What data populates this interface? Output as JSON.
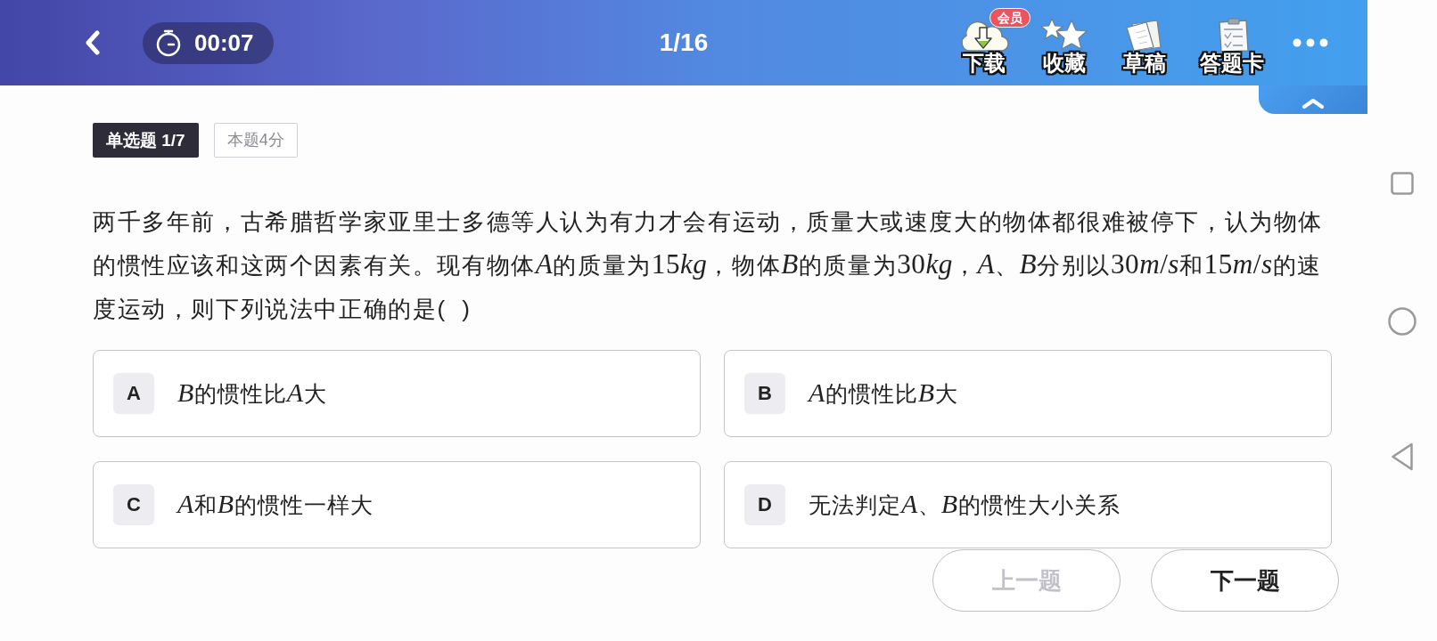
{
  "header": {
    "timer": "00:07",
    "progress": "1/16",
    "tools": [
      {
        "kind": "download",
        "label": "下载",
        "badge": "会员"
      },
      {
        "kind": "favorite",
        "label": "收藏"
      },
      {
        "kind": "draft",
        "label": "草稿"
      },
      {
        "kind": "answer_card",
        "label": "答题卡"
      }
    ]
  },
  "question": {
    "type_tag": "单选题 1/7",
    "score": "本题4分",
    "text_runs": [
      {
        "kind": "text",
        "text": "两千多年前，古希腊哲学家亚里士多德等人认为有力才会有运动，质量大或速度大的物体都很难被停下，认为物体的惯性应该和这两个因素有关。现有物体"
      },
      {
        "kind": "math_var",
        "text": "A"
      },
      {
        "kind": "text",
        "text": "的质量为"
      },
      {
        "kind": "math_num",
        "text": "15"
      },
      {
        "kind": "math_var",
        "text": "kg"
      },
      {
        "kind": "text",
        "text": "，物体"
      },
      {
        "kind": "math_var",
        "text": "B"
      },
      {
        "kind": "text",
        "text": "的质量为"
      },
      {
        "kind": "math_num",
        "text": "30"
      },
      {
        "kind": "math_var",
        "text": "kg"
      },
      {
        "kind": "text",
        "text": "，"
      },
      {
        "kind": "math_var",
        "text": "A"
      },
      {
        "kind": "text",
        "text": "、"
      },
      {
        "kind": "math_var",
        "text": "B"
      },
      {
        "kind": "text",
        "text": "分别以"
      },
      {
        "kind": "math_num",
        "text": "30"
      },
      {
        "kind": "math_var",
        "text": "m"
      },
      {
        "kind": "math_num",
        "text": "/"
      },
      {
        "kind": "math_var",
        "text": "s"
      },
      {
        "kind": "text",
        "text": "和"
      },
      {
        "kind": "math_num",
        "text": "15"
      },
      {
        "kind": "math_var",
        "text": "m"
      },
      {
        "kind": "math_num",
        "text": "/"
      },
      {
        "kind": "math_var",
        "text": "s"
      },
      {
        "kind": "text",
        "text": "的速度运动，则下列说法中正确的是(  )"
      }
    ],
    "options": [
      {
        "letter": "A",
        "selected": false,
        "text_runs": [
          {
            "kind": "math_var",
            "text": "B"
          },
          {
            "kind": "text",
            "text": "的惯性比"
          },
          {
            "kind": "math_var",
            "text": "A"
          },
          {
            "kind": "text",
            "text": "大"
          }
        ]
      },
      {
        "letter": "B",
        "selected": false,
        "text_runs": [
          {
            "kind": "math_var",
            "text": "A"
          },
          {
            "kind": "text",
            "text": "的惯性比"
          },
          {
            "kind": "math_var",
            "text": "B"
          },
          {
            "kind": "text",
            "text": "大"
          }
        ]
      },
      {
        "letter": "C",
        "selected": false,
        "text_runs": [
          {
            "kind": "math_var",
            "text": "A"
          },
          {
            "kind": "text",
            "text": "和"
          },
          {
            "kind": "math_var",
            "text": "B"
          },
          {
            "kind": "text",
            "text": "的惯性一样大"
          }
        ]
      },
      {
        "letter": "D",
        "selected": false,
        "text_runs": [
          {
            "kind": "text",
            "text": "无法判定"
          },
          {
            "kind": "math_var",
            "text": "A"
          },
          {
            "kind": "text",
            "text": "、"
          },
          {
            "kind": "math_var",
            "text": "B"
          },
          {
            "kind": "text",
            "text": "的惯性大小关系"
          }
        ]
      }
    ]
  },
  "navigation": [
    {
      "label": "上一题",
      "disabled": true
    },
    {
      "label": "下一题",
      "disabled": false
    }
  ]
}
